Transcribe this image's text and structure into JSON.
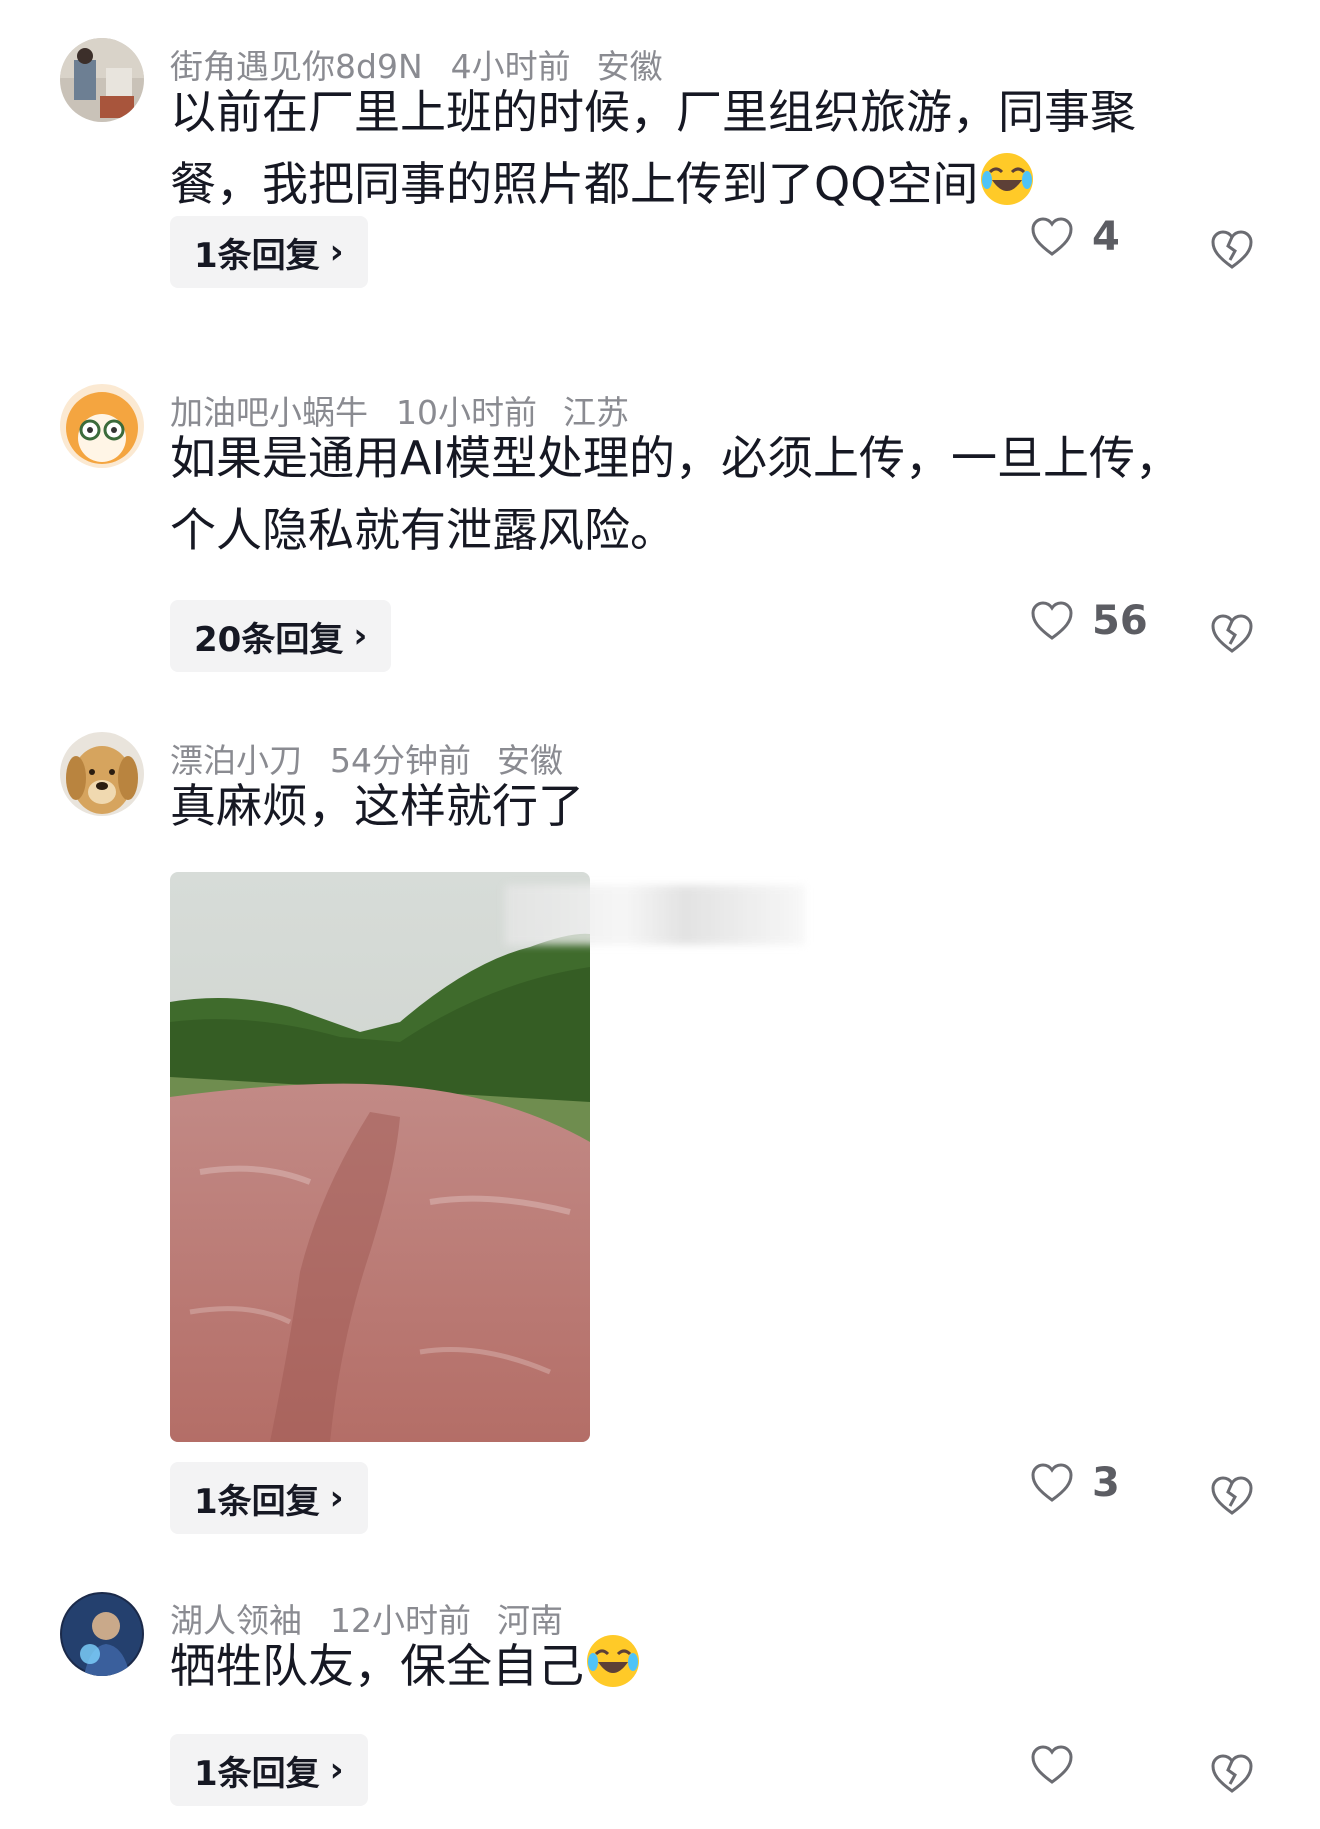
{
  "comments": [
    {
      "username": "街角遇见你8d9N",
      "time": "4小时前",
      "location": "安徽",
      "text": "以前在厂里上班的时候，厂里组织旅游，同事聚餐，我把同事的照片都上传到了QQ空间",
      "reply_label": "1条回复",
      "likes": "4"
    },
    {
      "username": "加油吧小蜗牛",
      "time": "10小时前",
      "location": "江苏",
      "text": "如果是通用AI模型处理的，必须上传，一旦上传，个人隐私就有泄露风险。",
      "reply_label": "20条回复",
      "likes": "56"
    },
    {
      "username": "漂泊小刀",
      "time": "54分钟前",
      "location": "安徽",
      "text": "真麻烦，这样就行了",
      "reply_label": "1条回复",
      "likes": "3"
    },
    {
      "username": "湖人领袖",
      "time": "12小时前",
      "location": "河南",
      "text": "牺牲队友，保全自己",
      "reply_label": "1条回复",
      "likes": ""
    }
  ],
  "icons": {
    "like": "heart-outline-icon",
    "dislike": "broken-heart-icon",
    "chevron": "chevron-right-icon",
    "emoji": "laughing-crying-emoji-icon"
  },
  "colors": {
    "text": "#161823",
    "meta": "#8a8b91",
    "reply_bg": "#f3f3f4"
  }
}
